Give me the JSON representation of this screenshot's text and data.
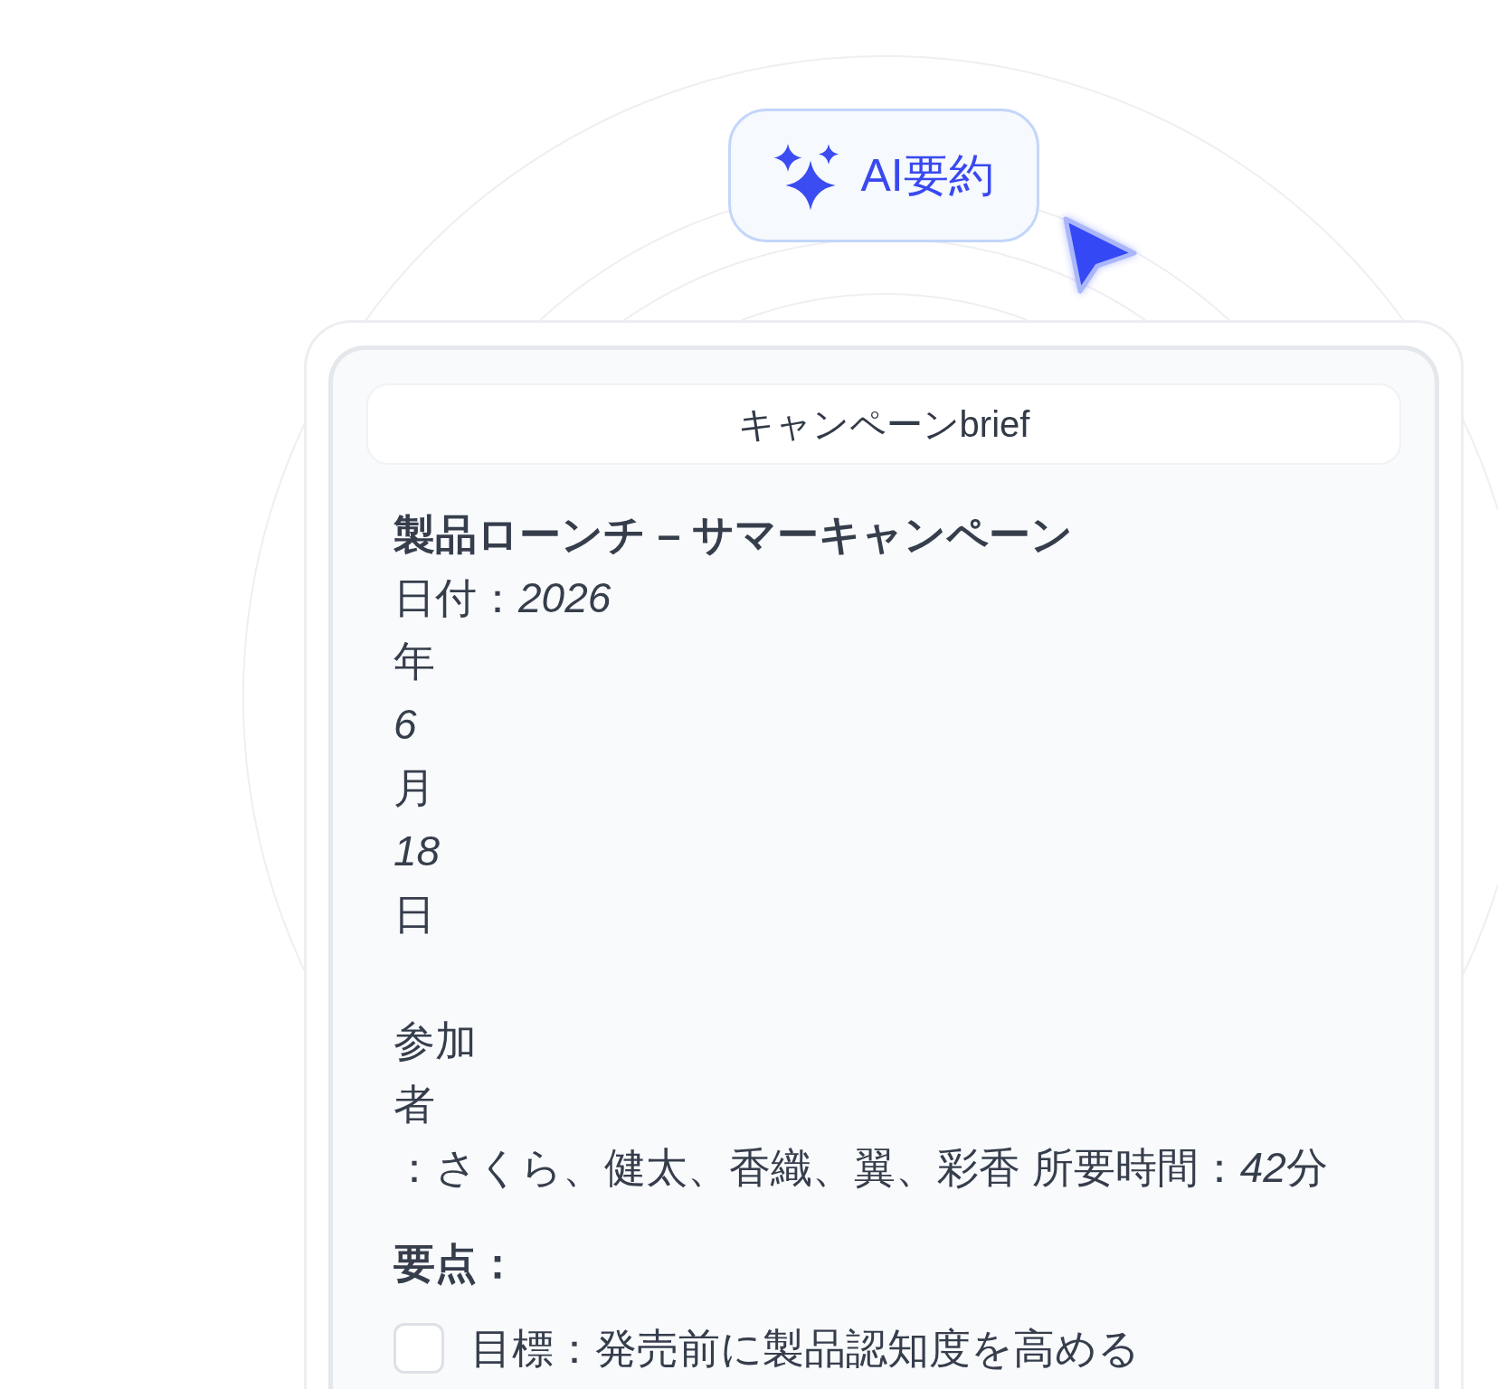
{
  "ai_button": {
    "label": "AI要約"
  },
  "document": {
    "title": "キャンペーンbrief",
    "heading": "製品ローンチ – サマーキャンペーン",
    "date_lines": [
      {
        "text": "日付：*2026*",
        "italic": false
      },
      {
        "text": "年",
        "italic": false
      },
      {
        "text": "6",
        "italic": true
      },
      {
        "text": "月",
        "italic": false
      },
      {
        "text": "18",
        "italic": true
      },
      {
        "text": "日",
        "italic": false
      }
    ],
    "attendee_lines": [
      {
        "parts": [
          {
            "text": "参加",
            "italic": false
          }
        ]
      },
      {
        "parts": [
          {
            "text": "者",
            "italic": false
          }
        ]
      },
      {
        "parts": [
          {
            "text": "：さくら、健太、香織、翼、彩香 所要時間：",
            "italic": false
          },
          {
            "text": "42",
            "italic": true
          },
          {
            "text": "分",
            "italic": false
          }
        ]
      }
    ],
    "key_points_heading": "要点：",
    "key_points": [
      {
        "text": "目標：発売前に製品認知度を高める",
        "checked": false
      }
    ]
  }
}
